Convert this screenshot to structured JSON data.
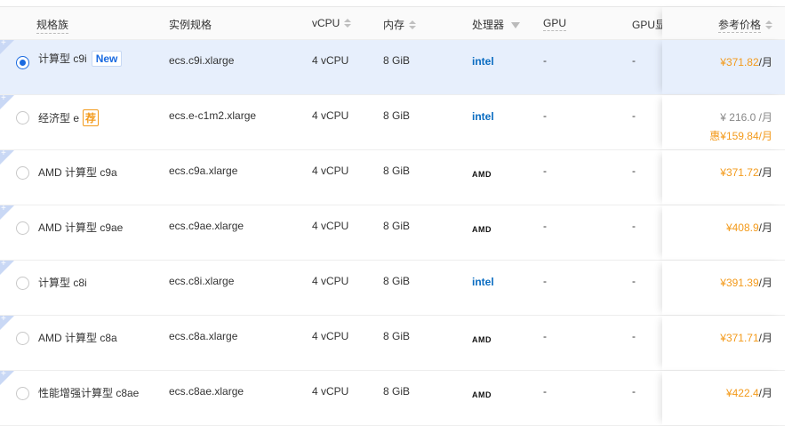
{
  "headers": {
    "family": "规格族",
    "spec": "实例规格",
    "vcpu": "vCPU",
    "memory": "内存",
    "processor": "处理器",
    "gpu": "GPU",
    "gpu_mem": "GPU显",
    "price": "参考价格"
  },
  "price_unit": "/月",
  "discount_prefix": "惠",
  "rows": [
    {
      "family": "计算型 c9i",
      "tag": "New",
      "spec": "ecs.c9i.xlarge",
      "vcpu": "4 vCPU",
      "mem": "8 GiB",
      "cpu": "intel",
      "gpu": "-",
      "gpu_mem": "-",
      "price": "¥371.82",
      "selected": true
    },
    {
      "family": "经济型 e",
      "tag": "荐",
      "spec": "ecs.e-c1m2.xlarge",
      "vcpu": "4 vCPU",
      "mem": "8 GiB",
      "cpu": "intel",
      "gpu": "-",
      "gpu_mem": "-",
      "orig_price": "¥ 216.0 /月",
      "price": "¥159.84"
    },
    {
      "family": "AMD 计算型 c9a",
      "spec": "ecs.c9a.xlarge",
      "vcpu": "4 vCPU",
      "mem": "8 GiB",
      "cpu": "AMD",
      "gpu": "-",
      "gpu_mem": "-",
      "price": "¥371.72"
    },
    {
      "family": "AMD 计算型 c9ae",
      "spec": "ecs.c9ae.xlarge",
      "vcpu": "4 vCPU",
      "mem": "8 GiB",
      "cpu": "AMD",
      "gpu": "-",
      "gpu_mem": "-",
      "price": "¥408.9"
    },
    {
      "family": "计算型 c8i",
      "spec": "ecs.c8i.xlarge",
      "vcpu": "4 vCPU",
      "mem": "8 GiB",
      "cpu": "intel",
      "gpu": "-",
      "gpu_mem": "-",
      "price": "¥391.39"
    },
    {
      "family": "AMD 计算型 c8a",
      "spec": "ecs.c8a.xlarge",
      "vcpu": "4 vCPU",
      "mem": "8 GiB",
      "cpu": "AMD",
      "gpu": "-",
      "gpu_mem": "-",
      "price": "¥371.71"
    },
    {
      "family": "性能增强计算型 c8ae",
      "spec": "ecs.c8ae.xlarge",
      "vcpu": "4 vCPU",
      "mem": "8 GiB",
      "cpu": "AMD",
      "gpu": "-",
      "gpu_mem": "-",
      "price": "¥422.4"
    }
  ]
}
